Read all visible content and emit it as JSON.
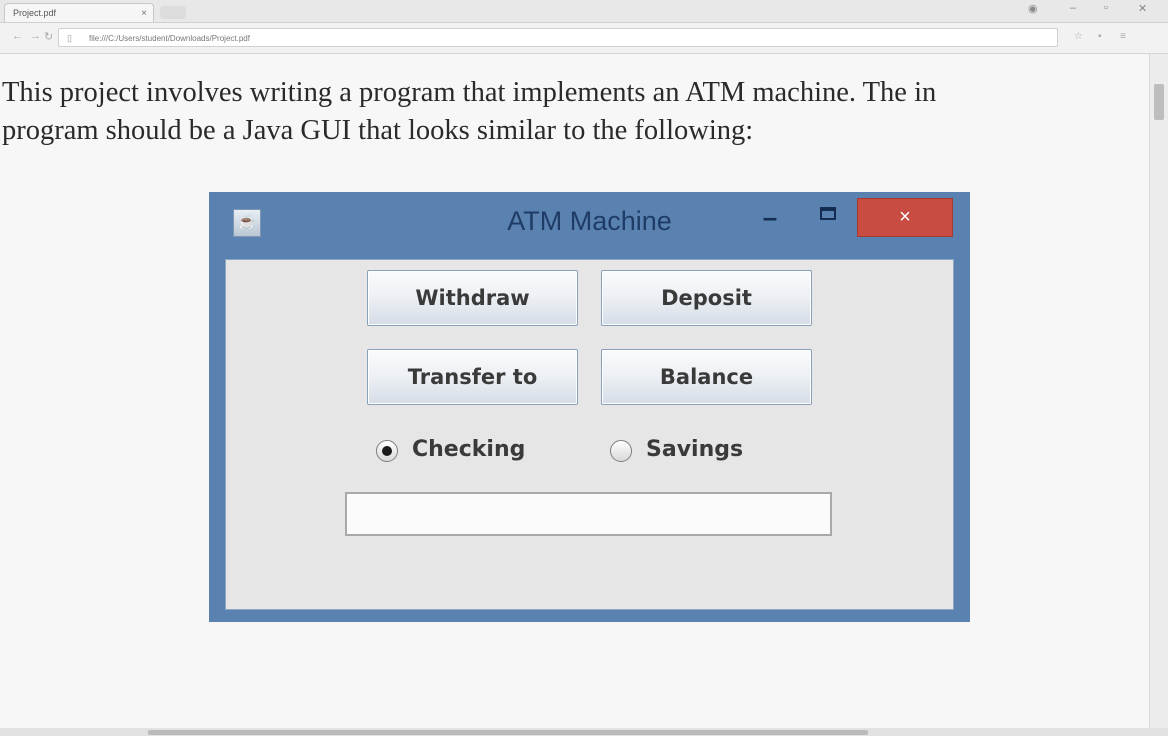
{
  "browser": {
    "tab_title": "Project.pdf",
    "tab_close": "×",
    "url": "file:///C:/Users/student/Downloads/Project.pdf",
    "icons": {
      "back": "back-arrow-icon",
      "forward": "forward-arrow-icon",
      "refresh": "refresh-icon",
      "page": "page-icon",
      "minimize": "minimize-icon",
      "maximize": "maximize-icon",
      "close": "close-icon"
    }
  },
  "document": {
    "line1": "This project involves writing a program that implements an ATM machine. The in",
    "line2": "program should be a Java GUI that looks similar to the following:"
  },
  "atm_window": {
    "title": "ATM Machine",
    "buttons": {
      "withdraw": "Withdraw",
      "deposit": "Deposit",
      "transfer": "Transfer to",
      "balance": "Balance"
    },
    "radios": [
      {
        "label": "Checking",
        "selected": true
      },
      {
        "label": "Savings",
        "selected": false
      }
    ],
    "amount_value": "",
    "close_glyph": "×",
    "minimize_glyph": "–",
    "colors": {
      "frame": "#5a82b0",
      "close_button": "#c84c42",
      "client": "#e6e6e6"
    }
  }
}
